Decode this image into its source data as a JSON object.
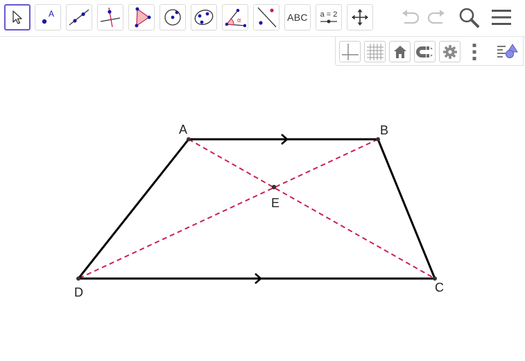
{
  "toolbar": {
    "tools": [
      {
        "name": "move-tool",
        "selected": true
      },
      {
        "name": "point-tool"
      },
      {
        "name": "line-tool"
      },
      {
        "name": "perpendicular-line-tool"
      },
      {
        "name": "polygon-tool"
      },
      {
        "name": "circle-tool"
      },
      {
        "name": "conic-tool"
      },
      {
        "name": "angle-tool"
      },
      {
        "name": "reflect-tool"
      },
      {
        "name": "text-tool",
        "label": "ABC"
      },
      {
        "name": "slider-tool",
        "label": "a = 2"
      },
      {
        "name": "move-graphics-view-tool"
      }
    ],
    "point_tool_label": "A",
    "angle_tool_label": "α",
    "actions": [
      "undo-icon",
      "redo-icon",
      "search-icon",
      "menu-icon"
    ]
  },
  "stylebar": {
    "buttons": [
      "axes-icon",
      "grid-icon",
      "home-icon",
      "magnet-icon",
      "gear-icon",
      "more-vertical-icon",
      "algebra-toggle-icon"
    ]
  },
  "construction": {
    "points": [
      {
        "label": "A"
      },
      {
        "label": "B"
      },
      {
        "label": "C"
      },
      {
        "label": "D"
      },
      {
        "label": "E"
      }
    ],
    "segments": [
      "AB",
      "BC",
      "CD",
      "DA"
    ],
    "diagonals": [
      "AC",
      "BD"
    ],
    "parallel_marks": [
      "AB",
      "DC"
    ],
    "colors": {
      "side": "#000000",
      "diagonal": "#cc1f4f",
      "point": "#333333",
      "tool_selected": "#6557d2",
      "tool_point": "#1a1aa6"
    }
  }
}
